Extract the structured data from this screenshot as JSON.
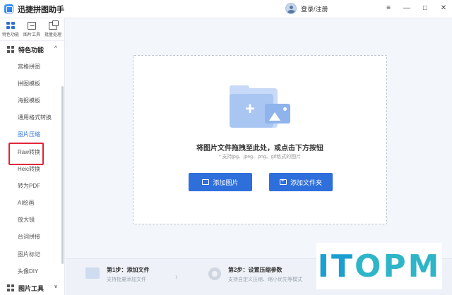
{
  "app": {
    "title": "迅捷拼图助手"
  },
  "account": {
    "login_label": "登录/注册"
  },
  "window_controls": {
    "menu": "≡",
    "minimize": "—",
    "maximize": "□",
    "close": "✕"
  },
  "top_nav": [
    {
      "label": "特色功能",
      "icon": "grid-icon"
    },
    {
      "label": "图片工具",
      "icon": "image-tool-icon"
    },
    {
      "label": "批量处理",
      "icon": "batch-icon"
    }
  ],
  "sidebar": {
    "section1": {
      "label": "特色功能",
      "chevron": "^"
    },
    "items": [
      "宫格拼图",
      "拼图模板",
      "海报模板",
      "通用格式转换",
      "图片压缩",
      "Raw转换",
      "Heic转换",
      "转为PDF",
      "AI绘画",
      "放大镜",
      "台词拼接",
      "图片标记",
      "头像DIY"
    ],
    "active_item": "图片压缩",
    "section2": {
      "label": "图片工具",
      "chevron": "v"
    }
  },
  "dropzone": {
    "title": "将图片文件拖拽至此处，或点击下方按钮",
    "subtitle": "* 支持jpg、jpeg、png、gif格式的图片",
    "add_image_label": "添加图片",
    "add_folder_label": "添加文件夹"
  },
  "steps": [
    {
      "title": "第1步：添加文件",
      "desc": "支持批量添加文件"
    },
    {
      "title": "第2步：设置压缩参数",
      "desc": "支持自定义压缩、缩小优先等模式"
    }
  ],
  "watermark": {
    "text_a": "IT",
    "text_b": "OPM"
  },
  "colors": {
    "accent": "#2e6fdc",
    "highlight": "#e0263a",
    "watermark": "#2fb5c8"
  }
}
